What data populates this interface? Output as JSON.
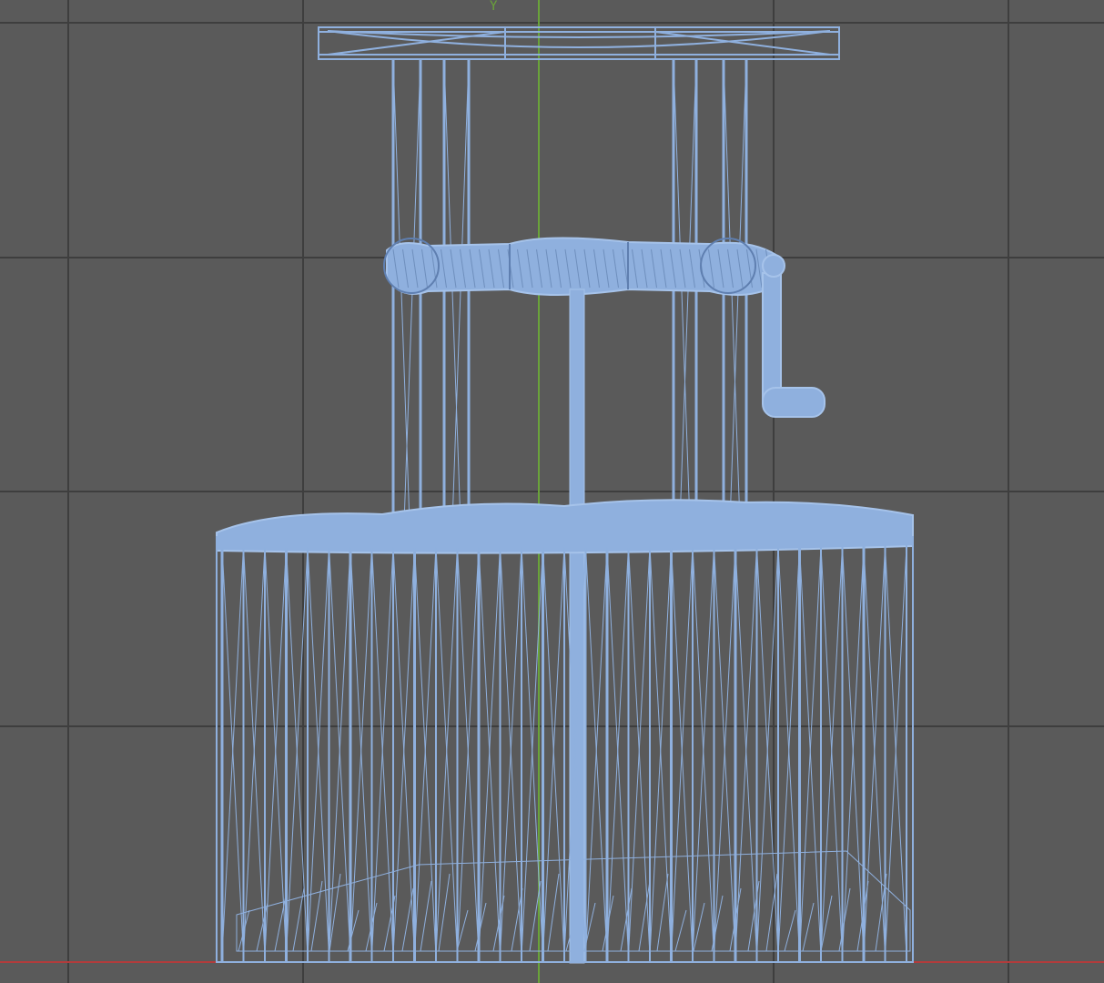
{
  "viewport": {
    "view": "wireframe",
    "axis_y_label": "Y"
  },
  "colors": {
    "background": "#5a5a5a",
    "grid_line": "#3e3e3e",
    "wire": "#8fb0de",
    "wire_dense": "#9ab8e4",
    "axis_y": "#6aa33a",
    "axis_x": "#b23c3c"
  },
  "objects": [
    {
      "name": "top-plate"
    },
    {
      "name": "press-columns"
    },
    {
      "name": "pressing-beam"
    },
    {
      "name": "crank-handle"
    },
    {
      "name": "press-screw"
    },
    {
      "name": "press-basket"
    }
  ]
}
